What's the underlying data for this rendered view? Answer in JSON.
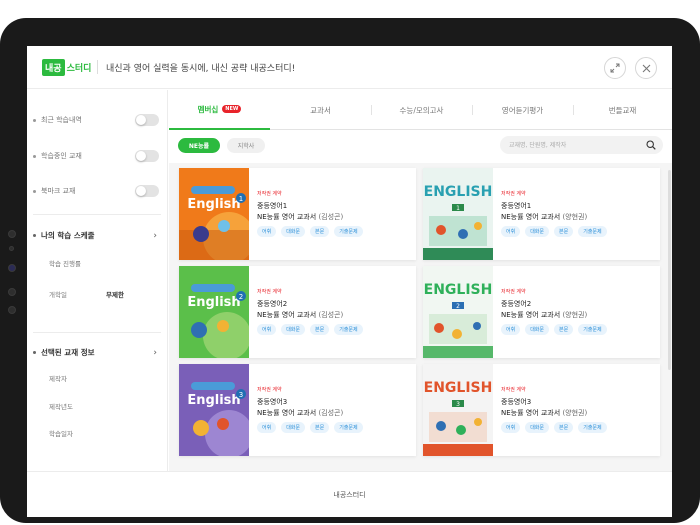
{
  "header": {
    "logo_box": "내공",
    "logo_text": "스터디",
    "slogan": "내신과 영어 실력을 동시에, 내신 공략 내공스터디!"
  },
  "sidebar": {
    "toggles": [
      {
        "label": "최근 학습내역"
      },
      {
        "label": "학습중인 교재"
      },
      {
        "label": "북마크 교재"
      }
    ],
    "schedule": {
      "title": "나의 학습 스케줄",
      "progress_label": "학습 진행률",
      "date_label": "개학일",
      "date_value": "무제한"
    },
    "book_info": {
      "title": "선택된 교재 정보",
      "items": [
        "제작자",
        "제작년도",
        "학습일자"
      ]
    }
  },
  "tabs": [
    {
      "label": "멤버십",
      "badge": "NEW"
    },
    {
      "label": "교과서"
    },
    {
      "label": "수능/모의고사"
    },
    {
      "label": "영어듣기평가"
    },
    {
      "label": "번들교재"
    }
  ],
  "filters": {
    "chips": [
      "NE능률",
      "지학사"
    ],
    "search_placeholder": "교재명, 단원명, 제작자"
  },
  "books": [
    {
      "publisher": "저작권 계약",
      "title": "중등영어1",
      "subtitle": "NE능률 영어 교과서",
      "author": "(김성곤)",
      "cover_label": "English",
      "cover_num": "1",
      "tags": [
        "어휘",
        "대화문",
        "본문",
        "기출문제"
      ]
    },
    {
      "publisher": "저작권 계약",
      "title": "중등영어1",
      "subtitle": "NE능률 영어 교과서",
      "author": "(양현권)",
      "cover_label": "ENGLISH",
      "cover_num": "1",
      "tags": [
        "어휘",
        "대화문",
        "본문",
        "기출문제"
      ]
    },
    {
      "publisher": "저작권 계약",
      "title": "중등영어2",
      "subtitle": "NE능률 영어 교과서",
      "author": "(김성곤)",
      "cover_label": "English",
      "cover_num": "2",
      "tags": [
        "어휘",
        "대화문",
        "본문",
        "기출문제"
      ]
    },
    {
      "publisher": "저작권 계약",
      "title": "중등영어2",
      "subtitle": "NE능률 영어 교과서",
      "author": "(양현권)",
      "cover_label": "ENGLISH",
      "cover_num": "2",
      "tags": [
        "어휘",
        "대화문",
        "본문",
        "기출문제"
      ]
    },
    {
      "publisher": "저작권 계약",
      "title": "중등영어3",
      "subtitle": "NE능률 영어 교과서",
      "author": "(김성곤)",
      "cover_label": "English",
      "cover_num": "3",
      "tags": [
        "어휘",
        "대화문",
        "본문",
        "기출문제"
      ]
    },
    {
      "publisher": "저작권 계약",
      "title": "중등영어3",
      "subtitle": "NE능률 영어 교과서",
      "author": "(양현권)",
      "cover_label": "ENGLISH",
      "cover_num": "3",
      "tags": [
        "어휘",
        "대화문",
        "본문",
        "기출문제"
      ]
    }
  ],
  "footer": {
    "label": "내공스터디"
  },
  "colors": {
    "accent": "#2cba3f",
    "badge": "#e8232a",
    "tag": "#2a8fd8"
  }
}
